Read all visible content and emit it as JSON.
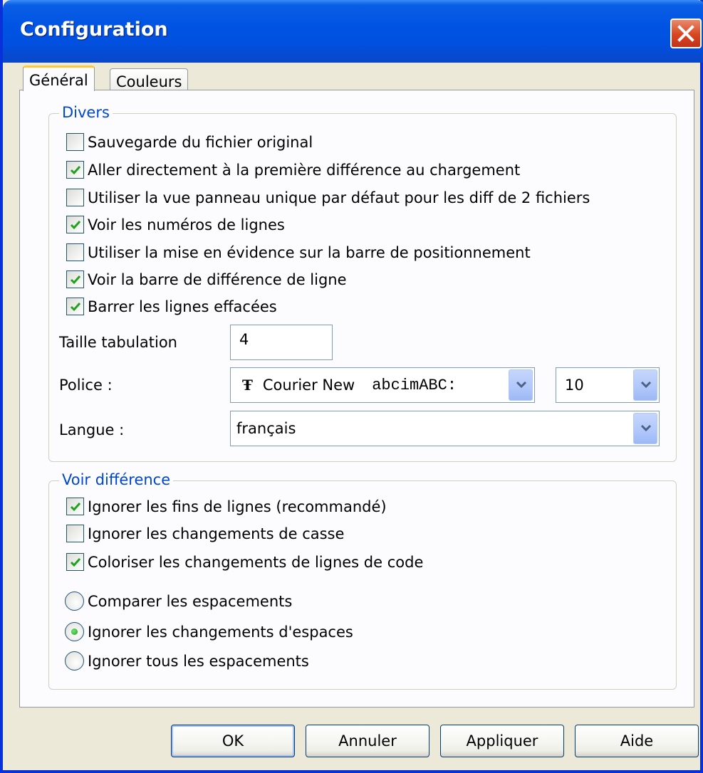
{
  "window": {
    "title": "Configuration"
  },
  "tabs": [
    {
      "label": "Général",
      "active": true
    },
    {
      "label": "Couleurs",
      "active": false
    }
  ],
  "divers": {
    "legend": "Divers",
    "checkboxes": [
      {
        "label": "Sauvegarde du fichier original",
        "checked": false
      },
      {
        "label": "Aller directement à la première différence au chargement",
        "checked": true
      },
      {
        "label": "Utiliser la vue panneau unique par défaut pour les diff de 2 fichiers",
        "checked": false
      },
      {
        "label": "Voir les numéros de lignes",
        "checked": true
      },
      {
        "label": "Utiliser la mise en évidence sur la barre de positionnement",
        "checked": false
      },
      {
        "label": "Voir la barre de différence de ligne",
        "checked": true
      },
      {
        "label": "Barrer les lignes effacées",
        "checked": true
      }
    ],
    "tab_size_label": "Taille tabulation",
    "tab_size_value": "4",
    "font_label": "Police :",
    "font_name": "Courier New",
    "font_sample": "abcimABC:",
    "font_size": "10",
    "language_label": "Langue :",
    "language_value": "français"
  },
  "voir_difference": {
    "legend": "Voir différence",
    "checkboxes": [
      {
        "label": "Ignorer les fins de lignes (recommandé)",
        "checked": true
      },
      {
        "label": "Ignorer les changements de casse",
        "checked": false
      },
      {
        "label": "Coloriser les changements de lignes de code",
        "checked": true
      }
    ],
    "radios": [
      {
        "label": "Comparer les espacements",
        "selected": false
      },
      {
        "label": "Ignorer les changements d'espaces",
        "selected": true
      },
      {
        "label": "Ignorer tous les espacements",
        "selected": false
      }
    ]
  },
  "buttons": {
    "ok": "OK",
    "cancel": "Annuler",
    "apply": "Appliquer",
    "help": "Aide"
  }
}
